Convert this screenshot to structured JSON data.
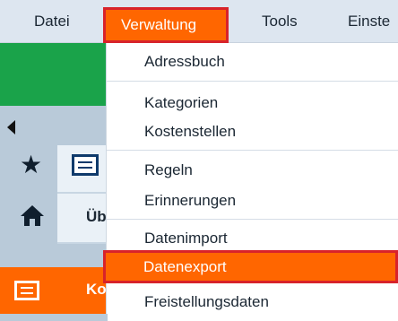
{
  "menubar": {
    "datei": "Datei",
    "verwaltung": "Verwaltung",
    "tools": "Tools",
    "einst": "Einste"
  },
  "background": {
    "ue_label": "Üb",
    "ko_label": "Ko"
  },
  "dropdown": {
    "items": [
      "Adressbuch",
      "Kategorien",
      "Kostenstellen",
      "Regeln",
      "Erinnerungen",
      "Datenimport",
      "Datenexport",
      "Freistellungsdaten"
    ],
    "highlighted": "Datenexport"
  },
  "colors": {
    "accent": "#ff6600",
    "highlight_border": "#d8232a",
    "menubar": "#dde6f0",
    "green": "#1aa34a"
  }
}
